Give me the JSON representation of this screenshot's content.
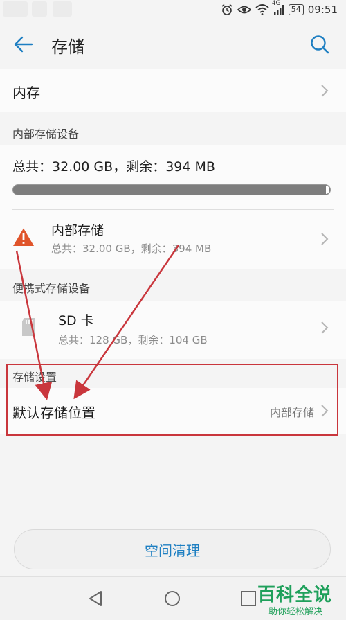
{
  "status_bar": {
    "network": "4G",
    "battery": "54",
    "time": "09:51"
  },
  "app_bar": {
    "title": "存储"
  },
  "memory_row": {
    "label": "内存"
  },
  "internal_section": {
    "header": "内部存储设备",
    "summary": "总共：32.00 GB，剩余：394 MB",
    "used_fraction": 0.988,
    "device": {
      "name": "内部存储",
      "detail": "总共：32.00 GB，剩余：394 MB"
    }
  },
  "portable_section": {
    "header": "便携式存储设备",
    "device": {
      "name": "SD 卡",
      "detail": "总共：128 GB，剩余：104 GB"
    }
  },
  "settings_section": {
    "header": "存储设置",
    "default_location_label": "默认存储位置",
    "default_location_value": "内部存储"
  },
  "actions": {
    "clean_label": "空间清理"
  },
  "watermark": {
    "title": "百科全说",
    "subtitle": "助你轻松解决"
  },
  "colors": {
    "accent": "#1e7fc2",
    "warning": "#e0542a",
    "annotation": "#c9363c",
    "watermark": "#1fa05b"
  }
}
